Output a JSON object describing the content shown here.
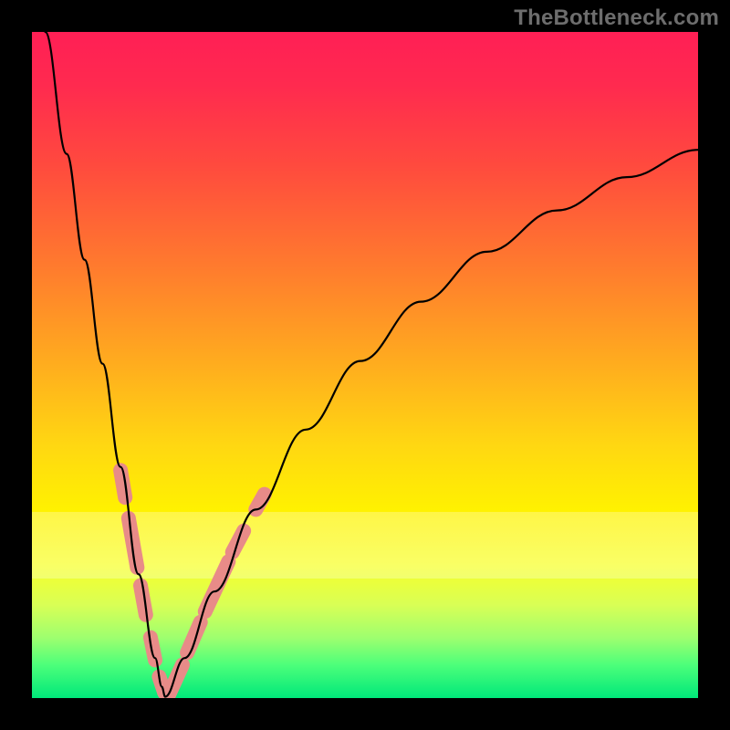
{
  "watermark": "TheBottleneck.com",
  "colors": {
    "frame": "#000000",
    "curve": "#000000",
    "bead": "#e88b88",
    "gradient_top": "#ff1f55",
    "gradient_bottom": "#00e87a"
  },
  "chart_data": {
    "type": "line",
    "title": "",
    "xlabel": "",
    "ylabel": "",
    "xlim": [
      0,
      100
    ],
    "ylim": [
      0,
      100
    ],
    "annotations": [
      "TheBottleneck.com"
    ],
    "note": "V-shaped bottleneck curve; axes unlabeled; values are normalized 0–100 estimated from pixel positions. y ≈ 0 at minimum near x ≈ 20.",
    "series": [
      {
        "name": "left-branch",
        "x": [
          2.0,
          5.2,
          7.9,
          10.6,
          13.3,
          16.0,
          18.5,
          19.5,
          20.0
        ],
        "y": [
          100.0,
          81.7,
          65.8,
          50.2,
          34.7,
          18.6,
          6.0,
          1.7,
          0.2
        ]
      },
      {
        "name": "right-branch",
        "x": [
          20.0,
          22.9,
          27.4,
          33.6,
          41.1,
          49.3,
          58.4,
          68.3,
          78.8,
          89.3,
          100.0
        ],
        "y": [
          0.2,
          6.0,
          16.0,
          28.3,
          40.3,
          50.6,
          59.5,
          67.0,
          73.2,
          78.2,
          82.3
        ]
      }
    ],
    "beads": {
      "name": "sausage-markers",
      "note": "Pink rounded markers placed along both branches in the lower (green/yellow) band.",
      "segments": [
        {
          "x1": 13.3,
          "y1": 34.2,
          "x2": 14.0,
          "y2": 30.1
        },
        {
          "x1": 14.5,
          "y1": 27.0,
          "x2": 15.8,
          "y2": 19.6
        },
        {
          "x1": 16.3,
          "y1": 16.9,
          "x2": 17.1,
          "y2": 12.5
        },
        {
          "x1": 17.8,
          "y1": 9.1,
          "x2": 18.5,
          "y2": 5.7
        },
        {
          "x1": 19.1,
          "y1": 3.2,
          "x2": 19.9,
          "y2": 0.8
        },
        {
          "x1": 20.5,
          "y1": 0.4,
          "x2": 22.6,
          "y2": 5.0
        },
        {
          "x1": 23.3,
          "y1": 6.8,
          "x2": 25.3,
          "y2": 11.4
        },
        {
          "x1": 26.0,
          "y1": 13.0,
          "x2": 29.5,
          "y2": 20.5
        },
        {
          "x1": 30.1,
          "y1": 21.9,
          "x2": 31.8,
          "y2": 25.1
        },
        {
          "x1": 33.6,
          "y1": 28.3,
          "x2": 34.9,
          "y2": 30.6
        }
      ]
    },
    "pale_band_y": [
      18,
      28
    ]
  }
}
